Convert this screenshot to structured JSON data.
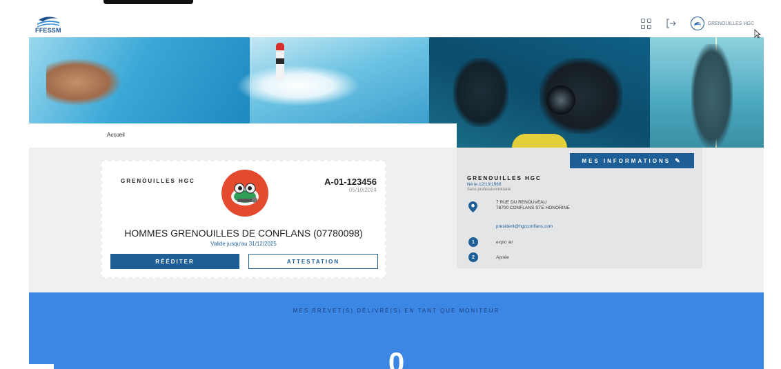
{
  "header": {
    "logo_text": "FFESSM",
    "user_name": "GRENOUILLES HGC"
  },
  "breadcrumb": {
    "label": "Accueil"
  },
  "licence_card": {
    "club_short": "GRENOUILLES HGC",
    "licence_number": "A-01-123456",
    "licence_date": "05/10/2024",
    "club_full": "HOMMES GRENOUILLES DE CONFLANS (07780098)",
    "validity": "Valide jusqu'au 31/12/2025",
    "reediter_label": "RÉÉDITER",
    "attestation_label": "ATTESTATION"
  },
  "mes_informations": {
    "button_label": "MES INFORMATIONS",
    "name": "GRENOUILLES HGC",
    "born": "Né le 12/10/1968",
    "profession": "Sans profession/retraité",
    "address_line1": "7 RUE DU RENOUVEAU",
    "address_line2": "78700 CONFLANS STE HONORINE",
    "email": "president@hgcconflans.com",
    "activities": [
      {
        "number": "1",
        "label": "explo air"
      },
      {
        "number": "2",
        "label": "Apnée"
      }
    ]
  },
  "brevets_section": {
    "title": "MES BREVET(S) DÉLIVRÉ(S) EN TANT QUE MONITEUR",
    "count": "0"
  },
  "colors": {
    "primary_blue": "#1d5e97",
    "section_blue": "#3c86e4",
    "club_logo_red": "#e44b2e"
  },
  "icons": [
    "ffessm-logo",
    "grid-icon",
    "logout-icon",
    "user-avatar-icon",
    "pencil-icon",
    "location-pin-icon"
  ]
}
